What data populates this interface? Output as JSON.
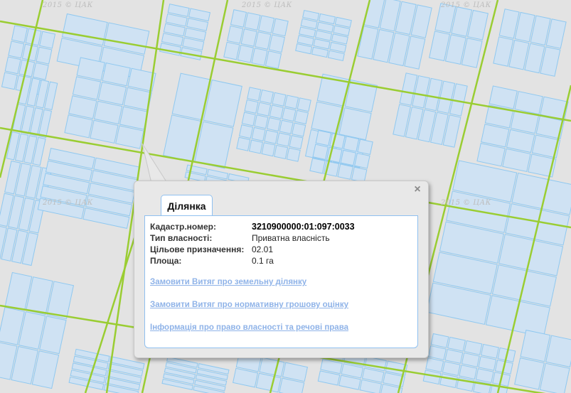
{
  "map": {
    "watermark": "2015 © ЦАК",
    "colors": {
      "background": "#e3e3e3",
      "parcel_fill": "#cfe2f3",
      "parcel_stroke": "#8fc8f0",
      "road": "#9acd32"
    }
  },
  "popup": {
    "tab_label": "Ділянка",
    "close_icon": "×",
    "fields": [
      {
        "label": "Кадастр.номер:",
        "value": "3210900000:01:097:0033"
      },
      {
        "label": "Тип власності:",
        "value": "Приватна власність"
      },
      {
        "label": "Цільове призначення:",
        "value": "02.01"
      },
      {
        "label": "Площа:",
        "value": "0.1 га"
      }
    ],
    "links": [
      "Замовити Витяг про земельну ділянку",
      "Замовити Витяг про нормативну грошову оцінку",
      "Інформація про право власності та речові права"
    ]
  }
}
